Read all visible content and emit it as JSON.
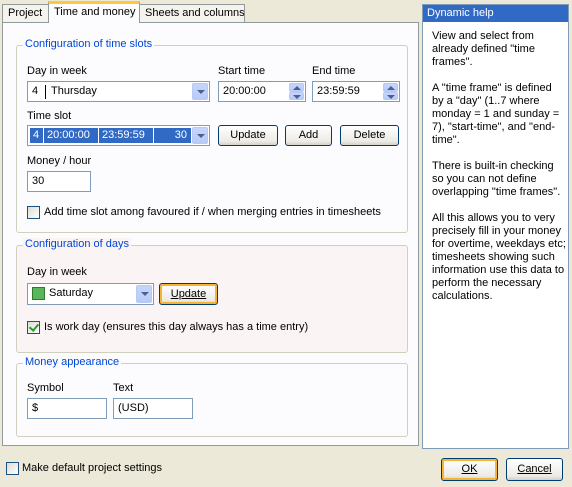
{
  "tabs": [
    "Project",
    "Time and money",
    "Sheets and columns"
  ],
  "time_slots": {
    "legend": "Configuration of time slots",
    "day_label": "Day in week",
    "day_num": "4",
    "day_value": "Thursday",
    "start_label": "Start time",
    "start_value": "20:00:00",
    "end_label": "End time",
    "end_value": "23:59:59",
    "slot_label": "Time slot",
    "slot": {
      "num": "4",
      "start": "20:00:00",
      "end": "23:59:59",
      "dur": "30"
    },
    "update_btn": "Update",
    "add_btn": "Add",
    "delete_btn": "Delete",
    "money_label": "Money / hour",
    "money_value": "30",
    "favoured_label": "Add time slot among favoured if / when merging entries in timesheets",
    "favoured_checked": false
  },
  "days": {
    "legend": "Configuration of days",
    "day_label": "Day in week",
    "day_value": "Saturday",
    "update_btn": "Update",
    "work_day_label": "Is work day (ensures this day always has a time entry)",
    "work_day_checked": true
  },
  "money": {
    "legend": "Money appearance",
    "symbol_label": "Symbol",
    "symbol_value": "$",
    "text_label": "Text",
    "text_value": "(USD)"
  },
  "footer": {
    "default_label": "Make default project settings",
    "ok": "OK",
    "cancel": "Cancel"
  },
  "help": {
    "title": "Dynamic help",
    "paragraphs": [
      "View and select from already defined \"time frames\".",
      "A \"time frame\" is defined by a \"day\" (1..7 where monday = 1 and sunday = 7), \"start-time\", and \"end-time\".",
      "There is built-in checking so you can not define overlapping \"time frames\".",
      "All this allows you to very precisely fill in your money for overtime, weekdays etc; timesheets showing such information use this data to perform the necessary calculations."
    ]
  },
  "colors": {
    "accent": "#0046d5",
    "help_title_bg": "#316ac5",
    "tab_highlight": "#ffc83c"
  }
}
